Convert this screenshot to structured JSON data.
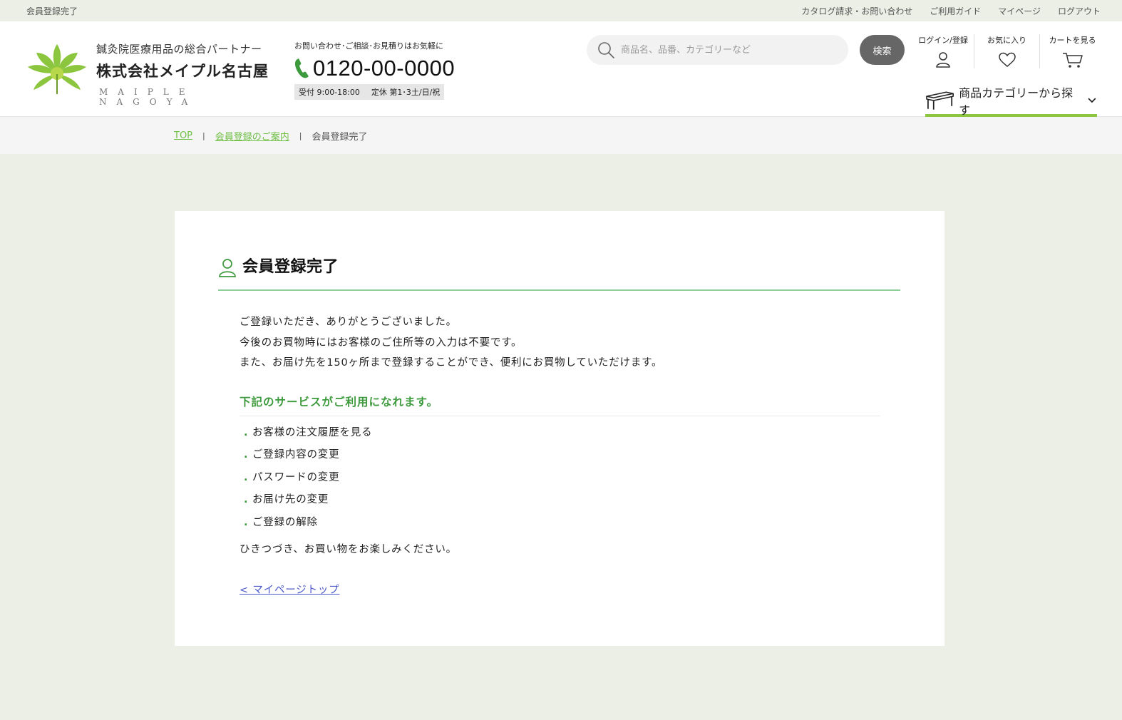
{
  "topbar": {
    "page_label": "会員登録完了",
    "links": [
      "カタログ請求・お問い合わせ",
      "ご利用ガイド",
      "マイページ",
      "ログアウト"
    ]
  },
  "logo": {
    "tagline": "鍼灸院医療用品の総合パートナー",
    "company": "株式会社メイプル名古屋",
    "english": "MAIPLE NAGOYA"
  },
  "contact": {
    "note": "お問い合わせ･ご相談･お見積りはお気軽に",
    "phone": "0120-00-0000",
    "hours": "受付 9:00-18:00",
    "holidays": "定休 第1･3土/日/祝"
  },
  "search": {
    "placeholder": "商品名、品番、カテゴリーなど",
    "button": "検索"
  },
  "utils": {
    "login": "ログイン/登録",
    "favorites": "お気に入り",
    "cart": "カートを見る"
  },
  "category_button": "商品カテゴリーから探す",
  "breadcrumb": {
    "top": "TOP",
    "parent": "会員登録のご案内",
    "current": "会員登録完了"
  },
  "main": {
    "title": "会員登録完了",
    "lines": [
      "ご登録いただき、ありがとうございました。",
      "今後のお買物時にはお客様のご住所等の入力は不要です。",
      "また、お届け先を150ヶ所まで登録することができ、便利にお買物していただけます。"
    ],
    "services_heading": "下記のサービスがご利用になれます。",
    "services": [
      "お客様の注文履歴を見る",
      "ご登録内容の変更",
      "パスワードの変更",
      "お届け先の変更",
      "ご登録の解除"
    ],
    "closing": "ひきつづき、お買い物をお楽しみください。",
    "back_link": "< マイページトップ"
  },
  "colors": {
    "accent_green": "#8cc63f",
    "heading_green": "#3c9a3c",
    "link_blue": "#4a59c8",
    "page_bg": "#ecefe6"
  }
}
